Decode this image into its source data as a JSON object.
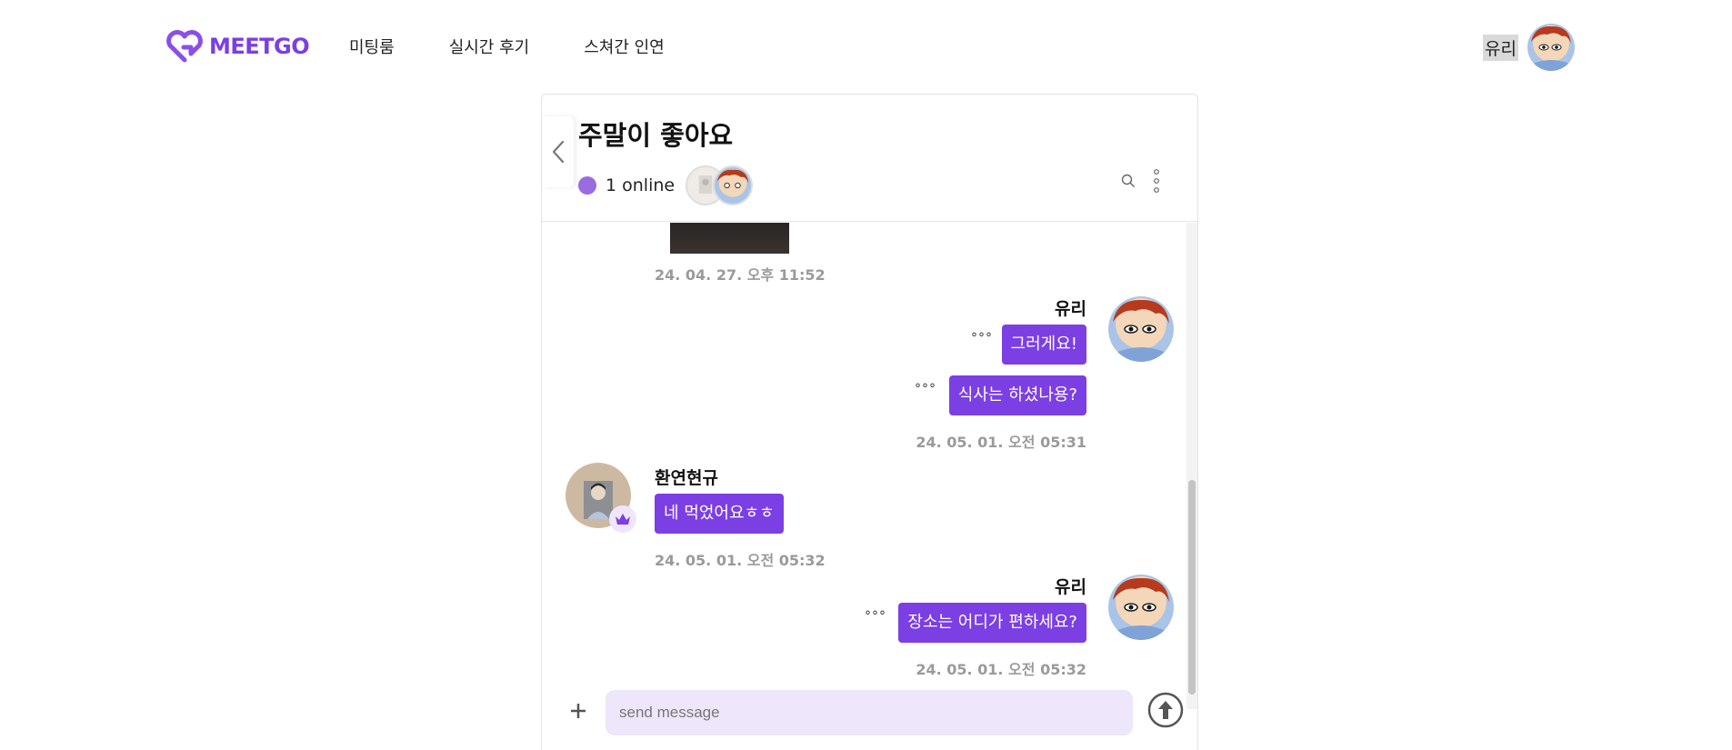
{
  "brand": {
    "name": "MEETGO",
    "accent": "#7b3fe4"
  },
  "nav": {
    "links": [
      "미팅룸",
      "실시간 후기",
      "스쳐간 인연"
    ],
    "user_name": "유리"
  },
  "chat": {
    "title": "주말이 좋아요",
    "online_text": "1 online",
    "messages": [
      {
        "timestamp": "24. 04. 27. 오후 11:52"
      },
      {
        "sender": "유리",
        "bubbles": [
          "그러게요!",
          "식사는 하셨나용?"
        ],
        "unread": "°°°",
        "timestamp": "24. 05. 01. 오전 05:31"
      },
      {
        "sender": "환연현규",
        "bubbles": [
          "네 먹었어요ㅎㅎ"
        ],
        "timestamp": "24. 05. 01. 오전 05:32"
      },
      {
        "sender": "유리",
        "bubbles": [
          "장소는 어디가 편하세요?"
        ],
        "unread": "°°°",
        "timestamp": "24. 05. 01. 오전 05:32"
      }
    ],
    "composer": {
      "placeholder": "send message"
    }
  },
  "icons": {
    "back": "chevron-left-icon",
    "search": "search-icon",
    "more": "more-vertical-icon",
    "plus": "plus-icon",
    "send": "arrow-up-circle-icon",
    "crown": "crown-icon"
  }
}
